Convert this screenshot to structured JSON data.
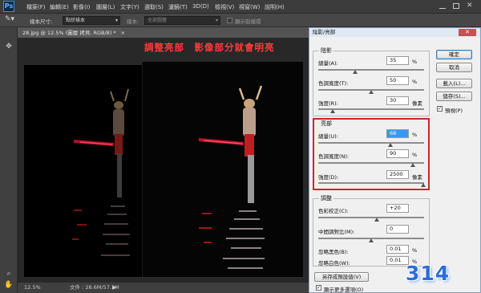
{
  "app": {
    "logo": "Ps"
  },
  "menubar": {
    "items": [
      "檔案(F)",
      "編輯(E)",
      "影像(I)",
      "圖層(L)",
      "文字(Y)",
      "選取(S)",
      "濾鏡(T)",
      "3D(D)",
      "檢視(V)",
      "視窗(W)",
      "說明(H)"
    ]
  },
  "options_bar": {
    "sample_size_label": "樣本尺寸:",
    "sample_size_value": "點狀樣本",
    "sample_label": "樣本:",
    "sample_value": "全部圖層",
    "show_ring_label": "顯示取樣環"
  },
  "document": {
    "tab_title": "28.jpg @ 12.5% (圖層 拷貝, RGB/8) *",
    "overlay_text": "調整亮部　影像部分就會明亮",
    "status_zoom": "12.5%",
    "status_doc": "文件 : 28.6M/57.1M"
  },
  "dialog": {
    "title": "陰影/亮部",
    "close_icon": "close-icon",
    "shadows": {
      "title": "陰影",
      "amount_label": "總量(A):",
      "amount_value": "35",
      "amount_unit": "%",
      "amount_level": 0.35,
      "tone_label": "色調寬度(T):",
      "tone_value": "50",
      "tone_unit": "%",
      "tone_level": 0.5,
      "radius_label": "強度(R):",
      "radius_value": "30",
      "radius_unit": "像素",
      "radius_level": 0.12
    },
    "highlights": {
      "title": "亮部",
      "amount_label": "總量(U):",
      "amount_value": "68",
      "amount_unit": "%",
      "amount_level": 0.68,
      "tone_label": "色調寬度(N):",
      "tone_value": "90",
      "tone_unit": "%",
      "tone_level": 0.9,
      "radius_label": "強度(D):",
      "radius_value": "2500",
      "radius_unit": "像素",
      "radius_level": 1.0
    },
    "adjustments": {
      "title": "調整",
      "color_label": "色彩校正(C):",
      "color_value": "+20",
      "color_level": 0.55,
      "midtone_label": "中間調對比(M):",
      "midtone_value": "0",
      "midtone_level": 0.5,
      "black_clip_label": "忽略黑色(B):",
      "black_clip_value": "0.01",
      "black_clip_unit": "%",
      "white_clip_label": "忽略白色(W):",
      "white_clip_value": "0.01",
      "white_clip_unit": "%"
    },
    "buttons": {
      "ok": "確定",
      "cancel": "取消",
      "load": "載入(L)...",
      "save": "儲存(S)...",
      "save_default": "另存成預設值(V)"
    },
    "preview_label": "預視(P)",
    "preview_checked": true,
    "more_options_label": "顯示更多選項(O)",
    "more_options_checked": true
  },
  "watermark": "314",
  "colors": {
    "accent_red": "#d2232a",
    "title_red": "#ff3a3a",
    "badge_blue": "#2f6dd8"
  }
}
